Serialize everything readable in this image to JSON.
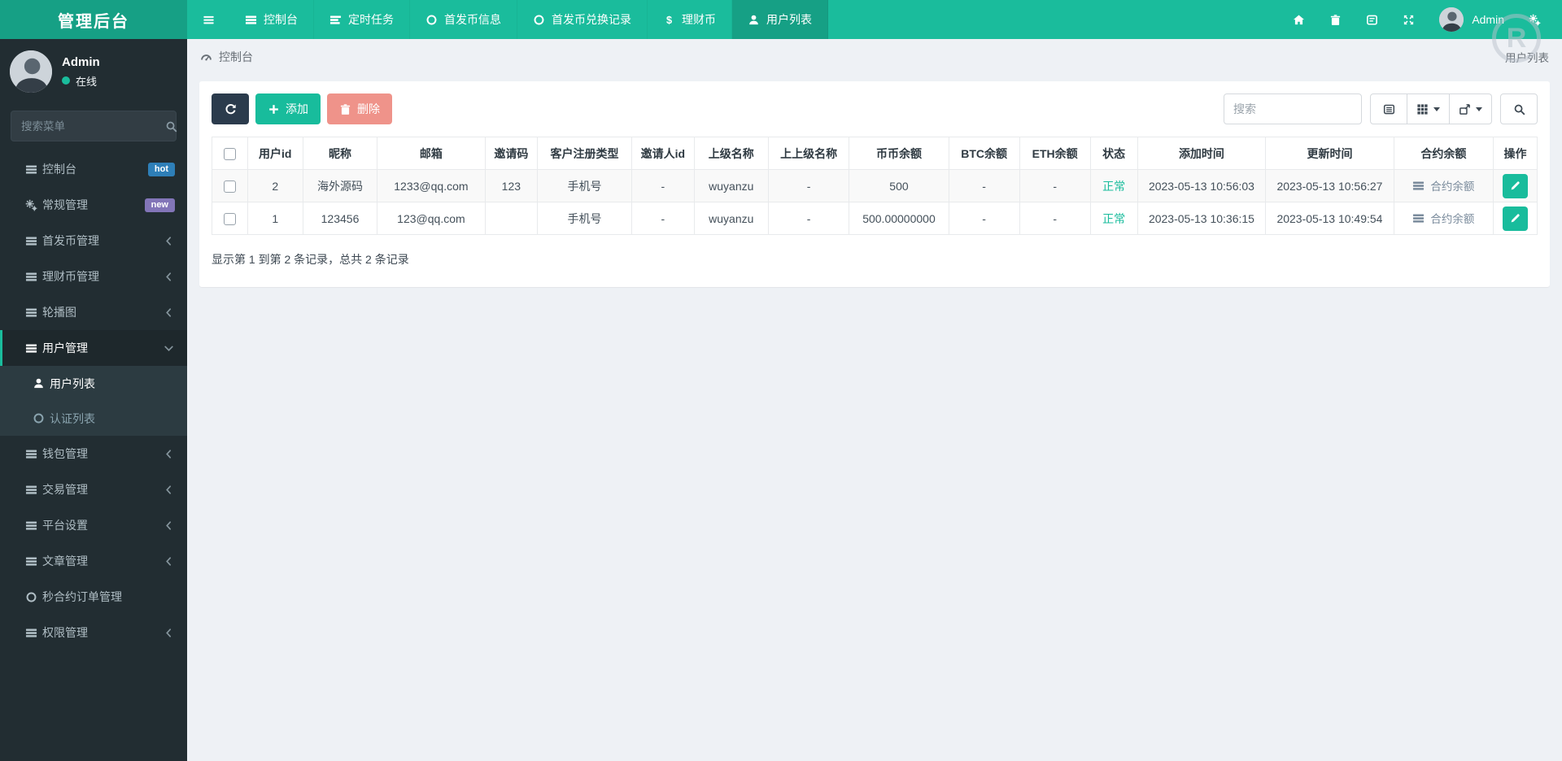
{
  "navbar": {
    "brand": "管理后台",
    "username": "Admin",
    "tabs": [
      {
        "slug": "dashboard",
        "icon": "list",
        "label": "控制台",
        "active": false
      },
      {
        "slug": "scheduled-tasks",
        "icon": "tasks",
        "label": "定时任务",
        "active": false
      },
      {
        "slug": "ico-info",
        "icon": "circle",
        "label": "首发币信息",
        "active": false
      },
      {
        "slug": "ico-exchange-records",
        "icon": "circle",
        "label": "首发币兑换记录",
        "active": false
      },
      {
        "slug": "wealth-coin",
        "icon": "dollar",
        "label": "理财币",
        "active": false
      },
      {
        "slug": "user-list",
        "icon": "user",
        "label": "用户列表",
        "active": true
      }
    ],
    "right_icons": [
      "home-icon",
      "trash-icon",
      "cache-icon",
      "fullscreen-icon",
      "cogs-icon"
    ]
  },
  "sidebar": {
    "profile": {
      "name": "Admin",
      "status": "在线"
    },
    "search_placeholder": "搜索菜单",
    "menu": [
      {
        "slug": "dashboard",
        "icon": "list",
        "label": "控制台",
        "badge": "hot",
        "badge_color": "#2e7fb8"
      },
      {
        "slug": "general-management",
        "icon": "gears",
        "label": "常规管理",
        "badge": "new",
        "badge_color": "#8275b8"
      },
      {
        "slug": "ico-management",
        "icon": "list",
        "label": "首发币管理",
        "arrow": "left"
      },
      {
        "slug": "wealth-coin-management",
        "icon": "list",
        "label": "理财币管理",
        "arrow": "left"
      },
      {
        "slug": "carousel",
        "icon": "list",
        "label": "轮播图",
        "arrow": "left"
      },
      {
        "slug": "user-management",
        "icon": "list",
        "label": "用户管理",
        "arrow": "down",
        "parent_active": true
      },
      {
        "slug": "user-list",
        "icon": "user",
        "label": "用户列表",
        "sub": true,
        "sub_active": true
      },
      {
        "slug": "auth-list",
        "icon": "circle",
        "label": "认证列表",
        "sub": true
      },
      {
        "slug": "wallet-management",
        "icon": "list",
        "label": "钱包管理",
        "arrow": "left"
      },
      {
        "slug": "trade-management",
        "icon": "list",
        "label": "交易管理",
        "arrow": "left"
      },
      {
        "slug": "platform-settings",
        "icon": "list",
        "label": "平台设置",
        "arrow": "left"
      },
      {
        "slug": "article-management",
        "icon": "list",
        "label": "文章管理",
        "arrow": "left"
      },
      {
        "slug": "seconds-contract-orders",
        "icon": "circle",
        "label": "秒合约订单管理"
      },
      {
        "slug": "permission-management",
        "icon": "list",
        "label": "权限管理",
        "arrow": "left"
      }
    ]
  },
  "breadcrumb": {
    "left": "控制台",
    "right": "用户列表"
  },
  "toolbar": {
    "add_label": "添加",
    "delete_label": "删除",
    "search_placeholder": "搜索"
  },
  "table": {
    "headers": [
      "用户id",
      "昵称",
      "邮箱",
      "邀请码",
      "客户注册类型",
      "邀请人id",
      "上级名称",
      "上上级名称",
      "币币余额",
      "BTC余额",
      "ETH余额",
      "状态",
      "添加时间",
      "更新时间",
      "合约余额",
      "操作"
    ],
    "contract_link_label": "合约余额",
    "rows": [
      {
        "id": "2",
        "nickname": "海外源码",
        "email": "1233@qq.com",
        "invite_code": "123",
        "register_type": "手机号",
        "inviter_id": "-",
        "parent": "wuyanzu",
        "grandparent": "-",
        "balance": "500",
        "btc": "-",
        "eth": "-",
        "status": "正常",
        "created": "2023-05-13 10:56:03",
        "updated": "2023-05-13 10:56:27"
      },
      {
        "id": "1",
        "nickname": "123456",
        "email": "123@qq.com",
        "invite_code": "",
        "register_type": "手机号",
        "inviter_id": "-",
        "parent": "wuyanzu",
        "grandparent": "-",
        "balance": "500.00000000",
        "btc": "-",
        "eth": "-",
        "status": "正常",
        "created": "2023-05-13 10:36:15",
        "updated": "2023-05-13 10:49:54"
      }
    ],
    "summary": "显示第 1 到第 2 条记录，总共 2 条记录"
  },
  "watermark_letter": "R",
  "colors": {
    "accent": "#1abc9c",
    "navbar_dark": "#16a085",
    "sidebar_bg": "#222d32",
    "submenu_bg": "#2c3b41",
    "status_ok": "#18bc9c",
    "badge_hot": "#2e7fb8",
    "badge_new": "#8275b8",
    "btn_refresh": "#2b3b4c",
    "btn_add": "#18bc9c",
    "btn_delete": "#ef938a",
    "contract_link": "#7a8b9c"
  }
}
